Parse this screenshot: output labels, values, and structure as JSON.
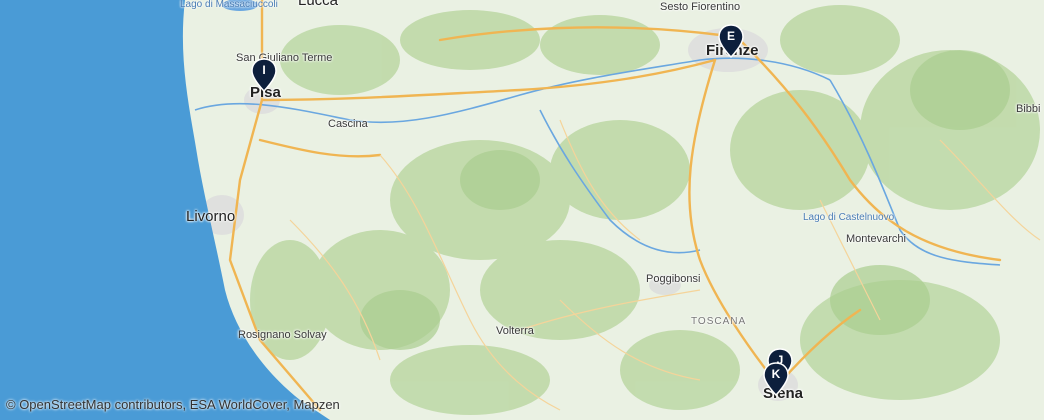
{
  "map": {
    "attribution": "© OpenStreetMap contributors, ESA WorldCover, Mapzen",
    "labels": {
      "lucca": "Lucca",
      "lago_massaciuccoli": "Lago di Massaciuccoli",
      "san_giuliano": "San Giuliano Terme",
      "pisa": "Pisa",
      "cascina": "Cascina",
      "livorno": "Livorno",
      "rosignano": "Rosignano Solvay",
      "volterra": "Volterra",
      "poggibonsi": "Poggibonsi",
      "toscana": "TOSCANA",
      "sesto": "Sesto Fiorentino",
      "firenze": "Firenze",
      "lago_castelnuovo": "Lago di Castelnuovo",
      "montevarchi": "Montevarchi",
      "bibbiena": "Bibbi",
      "siena": "Siena"
    },
    "markers": [
      {
        "id": "I",
        "label": "I",
        "near": "Pisa",
        "color": "#0d1f3c"
      },
      {
        "id": "E",
        "label": "E",
        "near": "Firenze",
        "color": "#0d1f3c"
      },
      {
        "id": "J",
        "label": "J",
        "near": "Siena",
        "color": "#0d1f3c"
      },
      {
        "id": "K",
        "label": "K",
        "near": "Siena",
        "color": "#0d1f3c"
      }
    ],
    "colors": {
      "sea": "#4a9bd6",
      "land": "#eaf1e3",
      "forest": "#bcd8a6",
      "motorway": "#f0b552",
      "river": "#6aa7e0",
      "marker": "#0d1f3c"
    }
  }
}
